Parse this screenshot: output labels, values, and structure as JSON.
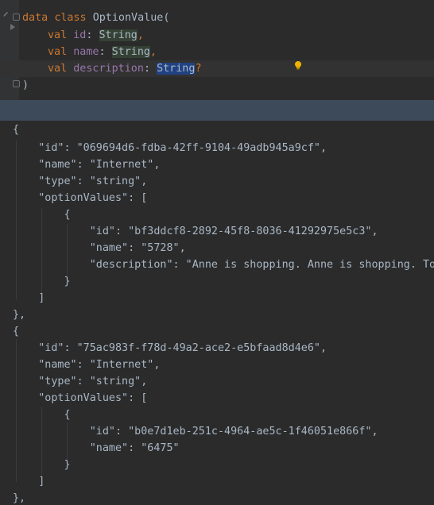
{
  "editor": {
    "l1_kw1": "data",
    "l1_kw2": "class",
    "l1_name": "OptionValue",
    "l1_paren": "(",
    "l2_kw": "val",
    "l2_prop": "id",
    "l2_type": "String",
    "l3_kw": "val",
    "l3_prop": "name",
    "l3_type": "String",
    "l4_kw": "val",
    "l4_prop": "description",
    "l4_type": "String",
    "l4_q": "?",
    "l5_close": ")"
  },
  "json_lines": [
    "{",
    "    \"id\": \"069694d6-fdba-42ff-9104-49adb945a9cf\",",
    "    \"name\": \"Internet\",",
    "    \"type\": \"string\",",
    "    \"optionValues\": [",
    "        {",
    "            \"id\": \"bf3ddcf8-2892-45f8-8036-41292975e5c3\",",
    "            \"name\": \"5728\",",
    "            \"description\": \"Anne is shopping. Anne is shopping. Tom",
    "        }",
    "    ]",
    "},",
    "{",
    "    \"id\": \"75ac983f-f78d-49a2-ace2-e5bfaad8d4e6\",",
    "    \"name\": \"Internet\",",
    "    \"type\": \"string\",",
    "    \"optionValues\": [",
    "        {",
    "            \"id\": \"b0e7d1eb-251c-4964-ae5c-1f46051e866f\",",
    "            \"name\": \"6475\"",
    "        }",
    "    ]",
    "},"
  ],
  "icons": {
    "intention": "lightbulb-icon",
    "edit": "pencil-icon",
    "fold": "fold-icon"
  },
  "colors": {
    "background": "#2b2b2b",
    "keyword": "#cc7832",
    "property": "#9876aa",
    "text": "#a9b7c6",
    "selection": "#214283",
    "bulb": "#f0b400"
  }
}
